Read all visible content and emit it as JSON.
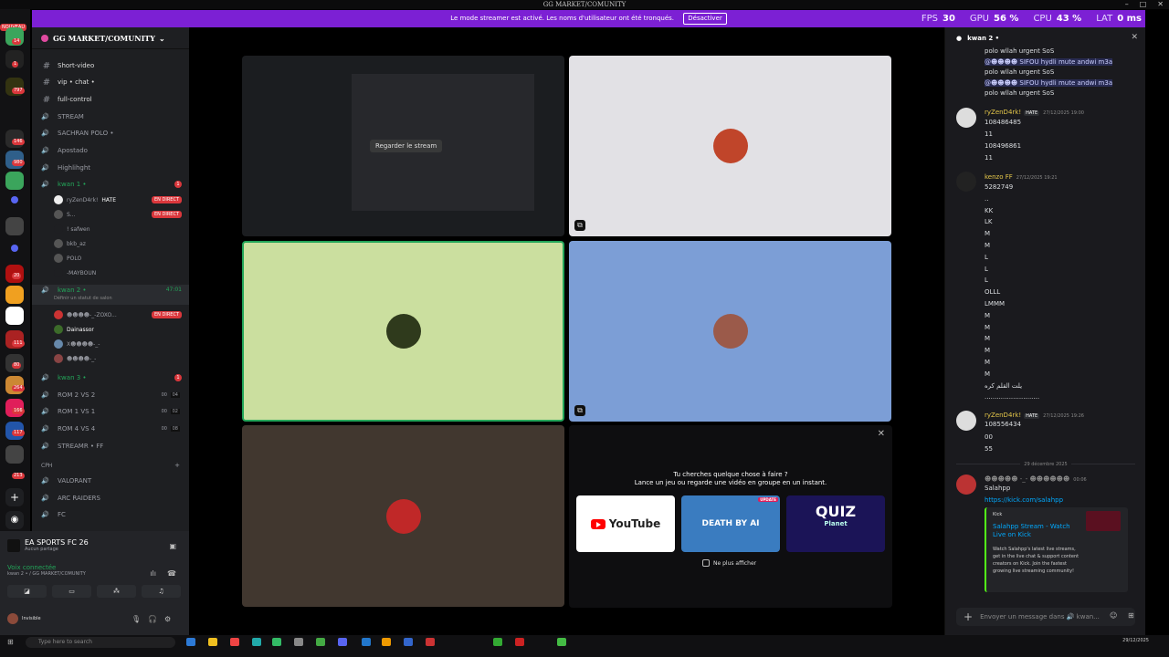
{
  "titlebar": {
    "title": "GG MARKET/COMUNITY"
  },
  "banner": {
    "text": "Le mode streamer est activé. Les noms d'utilisateur ont été tronqués.",
    "button": "Désactiver"
  },
  "perf": {
    "fps_label": "FPS",
    "fps": "30",
    "gpu_label": "GPU",
    "gpu": "56 %",
    "cpu_label": "CPU",
    "cpu": "43 %",
    "lat_label": "LAT",
    "lat": "0 ms"
  },
  "guilds": {
    "new_label": "NOUVEAU",
    "badges": [
      "14",
      "1",
      "797",
      "146",
      "980",
      "20",
      "111",
      "80",
      "264",
      "166",
      "117",
      "213"
    ]
  },
  "server": {
    "name": "GG MARKET/COMUNITY"
  },
  "channels": {
    "text": [
      "Short-video",
      "vip • chat •",
      "full-control"
    ],
    "voice_top": [
      "STREAM",
      "SACHRAN POLO •",
      "Apostado",
      "Highlihght"
    ],
    "kwan1": {
      "name": "kwan 1 •",
      "count": "1",
      "users": [
        "ryZenD4rk!",
        "S...",
        "! safwen",
        "bkb_az",
        "POLO",
        "-MAYBOUN"
      ],
      "hate": "HATE",
      "live": "EN DIRECT"
    },
    "kwan2": {
      "name": "kwan 2 •",
      "time": "47:01",
      "status": "Définir un statut de salon",
      "users": [
        "Dainassor"
      ]
    },
    "kwan3": {
      "name": "kwan 3 •",
      "count": "1"
    },
    "roms": [
      {
        "name": "ROM 2 VS 2",
        "a": "00",
        "b": "04"
      },
      {
        "name": "ROM 1 VS 1",
        "a": "00",
        "b": "02"
      },
      {
        "name": "ROM 4 VS 4",
        "a": "00",
        "b": "08"
      }
    ],
    "streamr": "STREAMR • FF",
    "category": "CPH",
    "games": [
      "VALORANT",
      "ARC RAIDERS",
      "FC"
    ]
  },
  "userpanel": {
    "game": "EA SPORTS FC 26",
    "game_sub": "Aucun partage",
    "voice": "Voix connectée",
    "voice_path": "kwan 2 • / GG MARKET/COMUNITY",
    "me_status": "Invisible"
  },
  "stage": {
    "watch": "Regarder le stream"
  },
  "promo": {
    "q1": "Tu cherches quelque chose à faire ?",
    "q2": "Lance un jeu ou regarde une vidéo en groupe en un instant.",
    "youtube": "YouTube",
    "death": "DEATH BY AI",
    "update": "UPDATE",
    "quiz": "QUIZ",
    "quiz_sub": "Planet",
    "noshow": "Ne plus afficher"
  },
  "chat": {
    "header": "kwan 2 •",
    "polo1": "polo wllah urgent SoS",
    "sifou1": "@☻☻☻☻ SIFOU hydli mute andwi m3a",
    "polo2": "polo wllah urgent SoS",
    "sifou2": "@☻☻☻☻ SIFOU hydli mute andwi m3a",
    "polo3": "polo wllah urgent SoS",
    "m1": {
      "name": "ryZenD4rk!",
      "tag": "HATE",
      "ts": "27/12/2025 19:00",
      "lines": [
        "108486485",
        "11",
        "108496861",
        "11"
      ]
    },
    "m2": {
      "name": "kenzo FF",
      "ts": "27/12/2025 19:21",
      "lines": [
        "5282749",
        "..",
        "KK",
        "LK",
        "M",
        "M",
        "L",
        "L",
        "L",
        "OLLL",
        "LMMM",
        "M",
        "M",
        "M",
        "M",
        "M",
        "M",
        "يلت القلم كره",
        "..........................."
      ]
    },
    "m3": {
      "name": "ryZenD4rk!",
      "tag": "HATE",
      "ts": "27/12/2025 19:26",
      "lines": [
        "108556434",
        "00",
        "55"
      ]
    },
    "divider": "29 décembre 2025",
    "m4": {
      "ts": "00:06",
      "text": "Salahpp",
      "link": "https://kick.com/salahpp"
    },
    "embed": {
      "provider": "Kick",
      "title": "Salahpp Stream - Watch Live on Kick",
      "desc": "Watch Salahpp's latest live streams, get in the live chat & support content creators on Kick. Join the fastest growing live streaming community!"
    },
    "composer": "Envoyer un message dans 🔊 kwan..."
  },
  "taskbar": {
    "search": "Type here to search",
    "date": "29/12/2025"
  }
}
